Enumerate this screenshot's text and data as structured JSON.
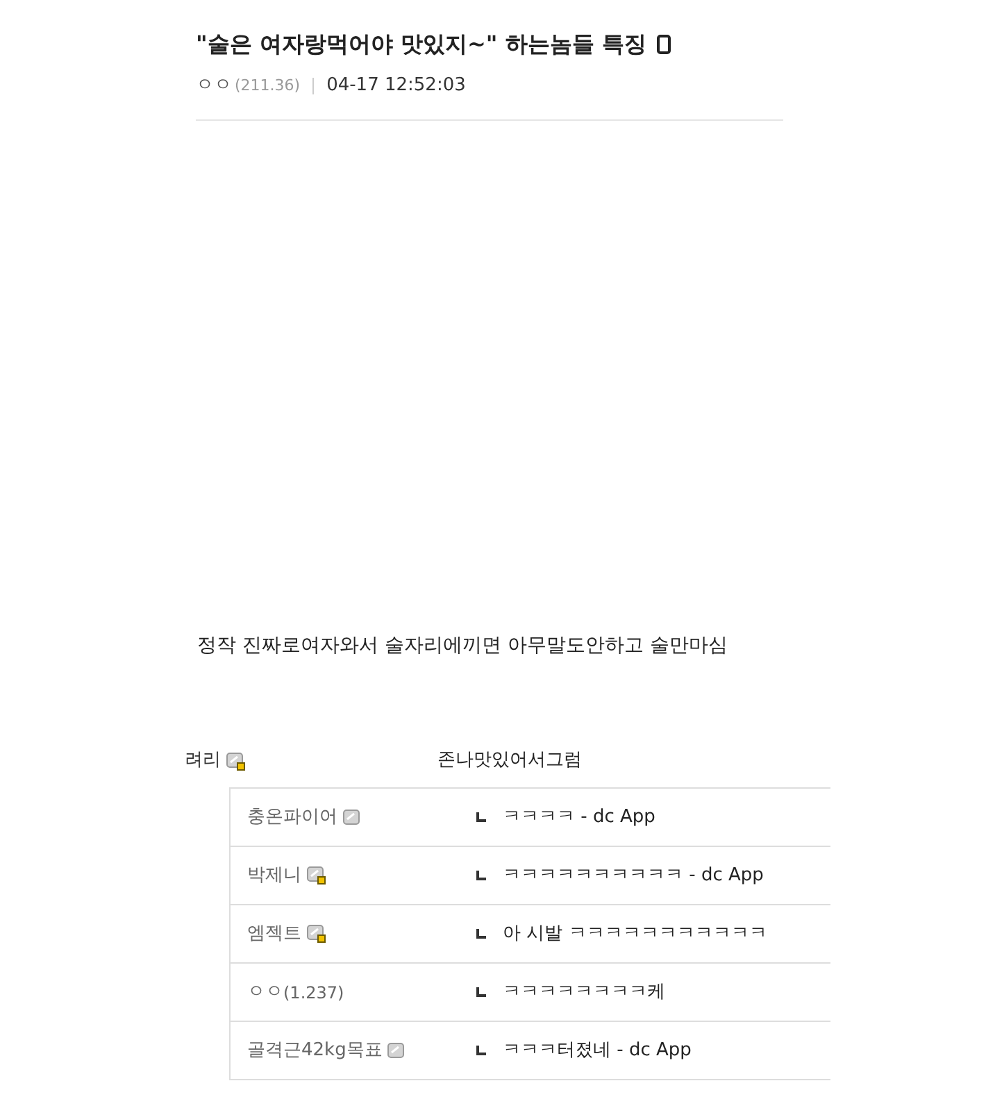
{
  "post": {
    "title": "\"술은 여자랑먹어야 맛있지~\" 하는놈들 특징",
    "mobile": true,
    "author": "ㅇㅇ",
    "ip": "(211.36)",
    "date": "04-17 12:52:03"
  },
  "body": "정작 진짜로여자와서 술자리에끼면 아무말도안하고 술만마심",
  "comment": {
    "author": "려리",
    "kind": "semi",
    "text": "존나맛있어서그럼"
  },
  "replies": [
    {
      "author": "충온파이어",
      "kind": "fixed",
      "text": "ㅋㅋㅋㅋ - dc App"
    },
    {
      "author": "박제니",
      "kind": "semi",
      "text": "ㅋㅋㅋㅋㅋㅋㅋㅋㅋㅋ - dc App"
    },
    {
      "author": "엠젝트",
      "kind": "semi",
      "text": "아 시발 ㅋㅋㅋㅋㅋㅋㅋㅋㅋㅋㅋ"
    },
    {
      "author": "ㅇㅇ",
      "ip": "(1.237)",
      "text": "ㅋㅋㅋㅋㅋㅋㅋㅋ케"
    },
    {
      "author": "골격근42kg목표",
      "kind": "fixed",
      "text": "ㅋㅋㅋ터졌네 - dc App"
    }
  ]
}
